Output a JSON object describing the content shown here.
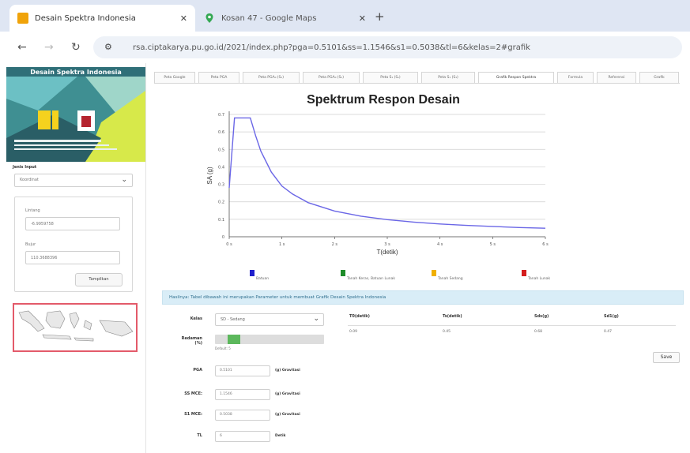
{
  "browser": {
    "tabs": [
      {
        "title": "Desain Spektra Indonesia",
        "active": true
      },
      {
        "title": "Kosan 47 - Google Maps",
        "active": false
      }
    ],
    "url": "rsa.ciptakarya.pu.go.id/2021/index.php?pga=0.5101&ss=1.1546&s1=0.5038&tl=6&kelas=2#grafik",
    "favicon_colors": {
      "desain": "#f0a30a",
      "maps": "#34a853"
    }
  },
  "sidebar": {
    "banner_title": "Desain Spektra Indonesia",
    "input_type_label": "Jenis Input",
    "input_type_value": "Koordinat",
    "lintang_label": "Lintang",
    "lintang_value": "-6.9959758",
    "bujur_label": "Bujur",
    "bujur_value": "110.3688396",
    "tampilkan": "Tampilkan"
  },
  "tabs": [
    "Peta Google",
    "Peta PGA",
    "Peta PGA₀ (S₁)",
    "Peta PGA₀ (S₁)",
    "Peta S₁ (Sₛ)",
    "Peta S₁ (S₁)",
    "Grafik Respon Spektra",
    "Formula",
    "Referensi",
    "Grafik"
  ],
  "active_tab_index": 6,
  "chart_data": {
    "type": "line",
    "title": "Spektrum Respon Desain",
    "xlabel": "T(detik)",
    "ylabel": "SA (g)",
    "xlim": [
      0,
      6
    ],
    "ylim": [
      0,
      0.7
    ],
    "x_ticks": [
      "0 s",
      "1 s",
      "2 s",
      "3 s",
      "4 s",
      "5 s",
      "6 s"
    ],
    "y_ticks": [
      "0",
      "0.1",
      "0.2",
      "0.3",
      "0.4",
      "0.5",
      "0.6",
      "0.7"
    ],
    "series": [
      {
        "color": "#6a66e6",
        "x": [
          0,
          0.1,
          0.2,
          0.3,
          0.4,
          0.5,
          0.6,
          0.8,
          1.0,
          1.2,
          1.5,
          2.0,
          2.5,
          3.0,
          3.5,
          4.0,
          4.5,
          5.0,
          5.5,
          6.0
        ],
        "y": [
          0.28,
          0.68,
          0.68,
          0.68,
          0.68,
          0.58,
          0.49,
          0.37,
          0.29,
          0.245,
          0.195,
          0.147,
          0.118,
          0.098,
          0.084,
          0.073,
          0.065,
          0.059,
          0.053,
          0.049
        ]
      }
    ],
    "grid": true,
    "legend": [
      {
        "label": "Batuan",
        "color": "#1f1fcc"
      },
      {
        "label": "Tanah Keras, Batuan Lunak",
        "color": "#1e8c2a"
      },
      {
        "label": "Tanah Sedang",
        "color": "#f0b000"
      },
      {
        "label": "Tanah Lunak",
        "color": "#d41e1e"
      }
    ]
  },
  "info": "Hasilnya: Tabel dibawah ini merupakan Parameter untuk membuat Grafik Desain Spektra Indonesia",
  "form": {
    "kelas_label": "Kelas",
    "kelas_value": "SD - Sedang",
    "redaman_label": "Redaman (%)",
    "redaman_value": "Default: 5",
    "pga_label": "PGA",
    "pga_value": "0.5101",
    "pga_unit": "(g) Gravitasi",
    "ss_label": "SS MCE:",
    "ss_value": "1.1546",
    "ss_unit": "(g) Gravitasi",
    "s1_label": "S1 MCE:",
    "s1_value": "0.5038",
    "s1_unit": "(g) Gravitasi",
    "tl_label": "TL",
    "tl_value": "6",
    "tl_unit": "Detik"
  },
  "table": {
    "headers": [
      "T0(detik)",
      "Ts(detik)",
      "Sds(g)",
      "Sd1(g)"
    ],
    "values": [
      "0.09",
      "0.45",
      "0.68",
      "0.47"
    ]
  },
  "save_label": "Save"
}
